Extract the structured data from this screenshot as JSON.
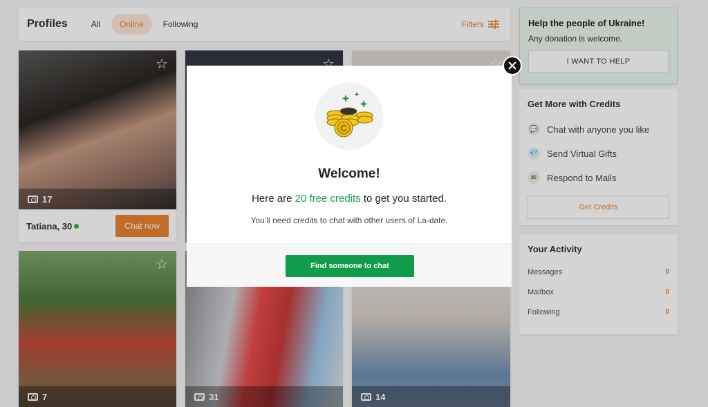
{
  "header": {
    "title": "Profiles",
    "tabs": [
      "All",
      "Online",
      "Following"
    ],
    "filters_label": "Filters"
  },
  "cards": [
    {
      "photo_count": "17",
      "name": "Tatiana, 30",
      "chat_label": "Chat now"
    },
    {
      "photo_count": "7"
    },
    {
      "photo_count": "31"
    },
    {
      "photo_count": "14"
    }
  ],
  "sidebar": {
    "ukraine": {
      "title": "Help the people of Ukraine!",
      "text": "Any donation is welcome.",
      "button": "I WANT TO HELP"
    },
    "credits": {
      "title": "Get More with Credits",
      "features": [
        "Chat with anyone you like",
        "Send Virtual Gifts",
        "Respond to Mails"
      ],
      "button": "Get Credits"
    },
    "activity": {
      "title": "Your Activity",
      "rows": [
        {
          "label": "Messages",
          "count": "0"
        },
        {
          "label": "Mailbox",
          "count": "0"
        },
        {
          "label": "Following",
          "count": "0"
        }
      ]
    }
  },
  "modal": {
    "title": "Welcome!",
    "lead_before": "Here are ",
    "lead_highlight": "20 free credits",
    "lead_after": " to get you started.",
    "note": "You’ll need credits to chat with other users of La-date.",
    "button": "Find someone to chat"
  }
}
